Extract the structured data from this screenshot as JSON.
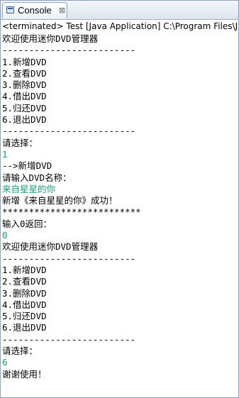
{
  "tab": {
    "label": "Console",
    "close_glyph": "⊠",
    "icon": "console-icon"
  },
  "status": {
    "text": "<terminated> Test [Java Application] C:\\Program Files\\J"
  },
  "colors": {
    "input_text": "#18a07a",
    "output_text": "#000000"
  },
  "console": {
    "lines": [
      {
        "text": "欢迎使用迷你DVD管理器",
        "type": "output"
      },
      {
        "text": "-------------------------",
        "type": "output"
      },
      {
        "text": "1.新增DVD",
        "type": "output"
      },
      {
        "text": "2.查看DVD",
        "type": "output"
      },
      {
        "text": "3.删除DVD",
        "type": "output"
      },
      {
        "text": "4.借出DVD",
        "type": "output"
      },
      {
        "text": "5.归还DVD",
        "type": "output"
      },
      {
        "text": "6.退出DVD",
        "type": "output"
      },
      {
        "text": "-------------------------",
        "type": "output"
      },
      {
        "text": "请选择：",
        "type": "output"
      },
      {
        "text": "1",
        "type": "input"
      },
      {
        "text": "-->新增DVD",
        "type": "output"
      },
      {
        "text": "请输入DVD名称：",
        "type": "output"
      },
      {
        "text": "来自星星的你",
        "type": "input"
      },
      {
        "text": "新增《来自星星的你》成功！",
        "type": "output"
      },
      {
        "text": "**************************",
        "type": "output"
      },
      {
        "text": "输入0返回：",
        "type": "output"
      },
      {
        "text": "0",
        "type": "input"
      },
      {
        "text": "欢迎使用迷你DVD管理器",
        "type": "output"
      },
      {
        "text": "-------------------------",
        "type": "output"
      },
      {
        "text": "1.新增DVD",
        "type": "output"
      },
      {
        "text": "2.查看DVD",
        "type": "output"
      },
      {
        "text": "3.删除DVD",
        "type": "output"
      },
      {
        "text": "4.借出DVD",
        "type": "output"
      },
      {
        "text": "5.归还DVD",
        "type": "output"
      },
      {
        "text": "6.退出DVD",
        "type": "output"
      },
      {
        "text": "-------------------------",
        "type": "output"
      },
      {
        "text": "请选择：",
        "type": "output"
      },
      {
        "text": "6",
        "type": "input"
      },
      {
        "text": "谢谢使用！",
        "type": "output"
      }
    ]
  }
}
